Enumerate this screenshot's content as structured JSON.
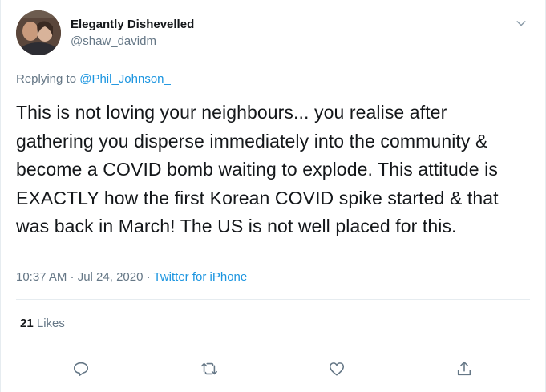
{
  "author": {
    "display_name": "Elegantly Dishevelled",
    "handle": "@shaw_davidm"
  },
  "reply": {
    "prefix": "Replying to ",
    "mention": "@Phil_Johnson_"
  },
  "tweet": {
    "text": "This is not loving your neighbours... you realise after gathering you disperse immediately into the community & become a COVID bomb waiting to explode. This attitude is EXACTLY how the first Korean COVID spike started & that was back in March! The US is not well placed for this.",
    "timestamp": "10:37 AM · Jul 24, 2020 · ",
    "source": "Twitter for iPhone"
  },
  "stats": {
    "likes_count": "21",
    "likes_label": " Likes"
  },
  "actions": {
    "reply_icon": "reply-icon",
    "retweet_icon": "retweet-icon",
    "like_icon": "heart-icon",
    "share_icon": "share-icon"
  },
  "colors": {
    "link": "#1b95e0",
    "secondary_text": "#657786",
    "primary_text": "#14171a",
    "divider": "#e6ecf0"
  }
}
